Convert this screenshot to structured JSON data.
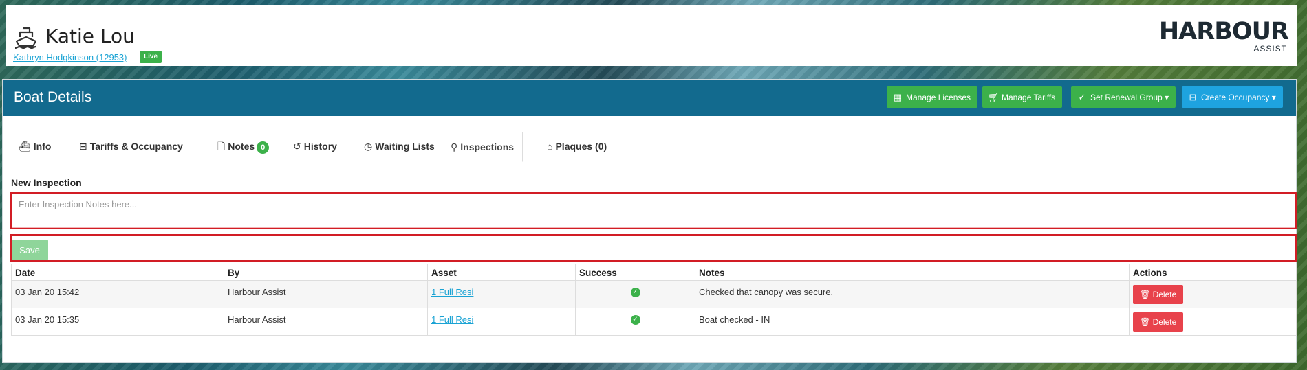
{
  "header": {
    "boat_name": "Katie Lou",
    "owner_link": "Kathryn Hodgkinson (12953)",
    "status_badge": "Live",
    "logo_main": "HARBOUR",
    "logo_sub": "ASSIST"
  },
  "panel": {
    "title": "Boat Details",
    "buttons": [
      {
        "label": "Manage Licenses",
        "icon": "table-icon"
      },
      {
        "label": "Manage Tariffs",
        "icon": "cart-icon"
      },
      {
        "label": "Set Renewal Group",
        "icon": "check-circle-icon",
        "caret": "▾"
      },
      {
        "label": "Create Occupancy",
        "icon": "bed-icon",
        "caret": "▾"
      }
    ]
  },
  "tabs": [
    {
      "label": "Info",
      "icon": "boat-icon"
    },
    {
      "label": "Tariffs & Occupancy",
      "icon": "bed-icon"
    },
    {
      "label": "Notes",
      "icon": "file-icon",
      "count": "0"
    },
    {
      "label": "History",
      "icon": "history-icon"
    },
    {
      "label": "Waiting Lists",
      "icon": "clock-icon"
    },
    {
      "label": "Inspections",
      "icon": "search-icon",
      "active": true
    },
    {
      "label": "Plaques (0)",
      "icon": "tag-icon"
    }
  ],
  "new_inspection": {
    "label": "New Inspection",
    "placeholder": "Enter Inspection Notes here...",
    "save_label": "Save"
  },
  "table": {
    "columns": [
      "Date",
      "By",
      "Asset",
      "Success",
      "Notes",
      "Actions"
    ],
    "rows": [
      {
        "date": "03 Jan 20 15:42",
        "by": "Harbour Assist",
        "asset": "1 Full Resi",
        "success": true,
        "notes": "Checked that canopy was secure.",
        "action": "Delete"
      },
      {
        "date": "03 Jan 20 15:35",
        "by": "Harbour Assist",
        "asset": "1 Full Resi",
        "success": true,
        "notes": "Boat checked - IN",
        "action": "Delete"
      }
    ]
  },
  "colors": {
    "heading": "#126a8e",
    "green": "#3cb14a",
    "blue": "#1ea3df",
    "danger": "#e8424b",
    "highlight": "#d21d25"
  }
}
